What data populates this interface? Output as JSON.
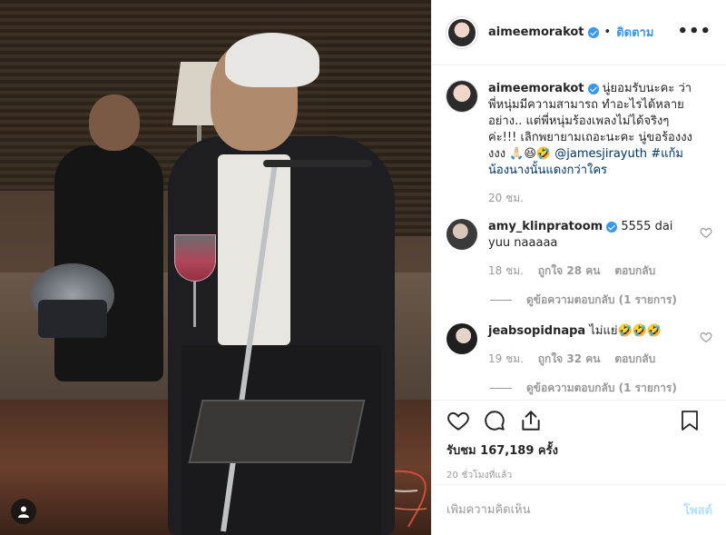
{
  "post": {
    "username": "aimeemorakot",
    "follow_label": "ติดตาม",
    "more_label": "•••"
  },
  "caption": {
    "username": "aimeemorakot",
    "text": "นู่ยอมรับนะคะ ว่าพี่หนุ่มมีความสามารถ ทำอะไรได้หลายอย่าง.. แต่พี่หนุ่มร้องเพลงไม่ได้จริงๆค่ะ!!! เลิกพยายามเถอะนะคะ นู่ขอร้องงงงงง 🙏🏻😆🤣 ",
    "mention": "@jamesjirayuth",
    "hashtag": "#แก้มน้องนางนั้นแดงกว่าใคร",
    "time": "20 ชม."
  },
  "comments": [
    {
      "username": "amy_klinpratoom",
      "text": "5555 dai yuu naaaaa",
      "time": "18 ชม.",
      "likes": "ถูกใจ 28 คน",
      "reply": "ตอบกลับ",
      "view_replies": "ดูข้อความตอบกลับ (1 รายการ)"
    },
    {
      "username": "jeabsopidnapa",
      "text": "ไม่แย่🤣🤣🤣",
      "time": "19 ชม.",
      "likes": "ถูกใจ 32 คน",
      "reply": "ตอบกลับ",
      "view_replies": "ดูข้อความตอบกลับ (1 รายการ)"
    }
  ],
  "stats": {
    "views": "รับชม 167,189 ครั้ง",
    "time_ago": "20 ชั่วโมงที่แล้ว"
  },
  "comment_box": {
    "placeholder": "เพิ่มความคิดเห็น",
    "post_label": "โพสต์"
  },
  "colors": {
    "link": "#3897f0",
    "verified": "#3897f0",
    "muted": "#999999"
  }
}
